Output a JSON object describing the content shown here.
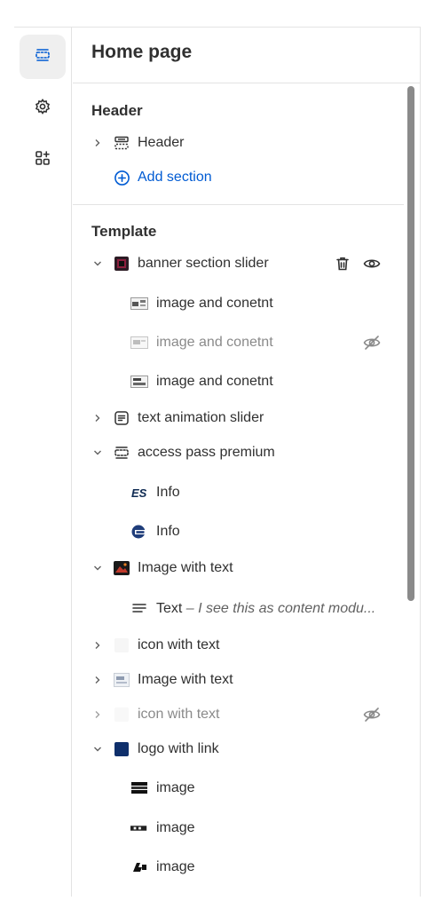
{
  "colors": {
    "accent": "#005bd3",
    "text": "#303030",
    "muted": "#8a8a8a",
    "border": "#e3e3e3"
  },
  "rail": {
    "items": [
      {
        "name": "sections",
        "icon": "sections-icon",
        "active": true
      },
      {
        "name": "theme-settings",
        "icon": "gear-icon",
        "active": false
      },
      {
        "name": "apps",
        "icon": "apps-add-icon",
        "active": false
      }
    ]
  },
  "panel": {
    "title": "Home page",
    "header_group": {
      "title": "Header",
      "items": [
        {
          "label": "Header",
          "icon": "header-layout-icon"
        }
      ],
      "add_section": "Add section"
    },
    "template_group": {
      "title": "Template",
      "items": [
        {
          "label": "banner section slider",
          "expanded": true
        },
        {
          "label": "image and conetnt"
        },
        {
          "label": "image and conetnt",
          "hidden": true
        },
        {
          "label": "image and conetnt"
        },
        {
          "label": "text animation slider",
          "expanded": false
        },
        {
          "label": "access pass premium",
          "expanded": true
        },
        {
          "label": "Info"
        },
        {
          "label": "Info"
        },
        {
          "label": "Image with text",
          "expanded": true
        },
        {
          "label": "Text",
          "subtitle": " – I see this as content modu..."
        },
        {
          "label": "icon with text",
          "expanded": false
        },
        {
          "label": "Image with text",
          "expanded": false
        },
        {
          "label": "icon with text",
          "expanded": false,
          "hidden": true
        },
        {
          "label": "logo with link",
          "expanded": true
        },
        {
          "label": "image"
        },
        {
          "label": "image"
        },
        {
          "label": "image"
        }
      ]
    }
  }
}
